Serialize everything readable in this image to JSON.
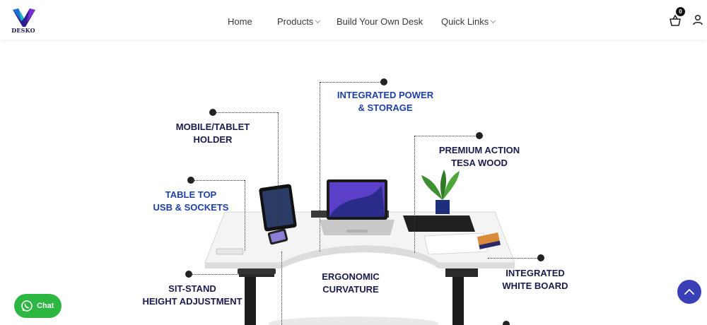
{
  "brand": {
    "name": "DESKO"
  },
  "nav": [
    {
      "label": "Home",
      "dropdown": false
    },
    {
      "label": "Products",
      "dropdown": true
    },
    {
      "label": "Build Your Own Desk",
      "dropdown": false
    },
    {
      "label": "Quick Links",
      "dropdown": true
    }
  ],
  "cart": {
    "count": "0",
    "icon": "basket-icon"
  },
  "account": {
    "icon": "user-icon"
  },
  "features": {
    "integrated_power": "INTEGRATED POWER\n& STORAGE",
    "mobile_holder": "MOBILE/TABLET\nHOLDER",
    "premium_wood": "PREMIUM ACTION\nTESA WOOD",
    "usb_sockets": "TABLE TOP\nUSB & SOCKETS",
    "ergonomic": "ERGONOMIC\nCURVATURE",
    "white_board": "INTEGRATED\nWHITE BOARD",
    "sit_stand": "SIT-STAND\nHEIGHT ADJUSTMENT"
  },
  "chat": {
    "label": "Chat",
    "icon": "whatsapp-icon"
  },
  "scroll_top": {
    "icon": "chevron-up-icon"
  },
  "colors": {
    "accent_blue": "#1d3fa8",
    "chat_green": "#2cb742",
    "scroll_button": "#3b3fb6"
  }
}
